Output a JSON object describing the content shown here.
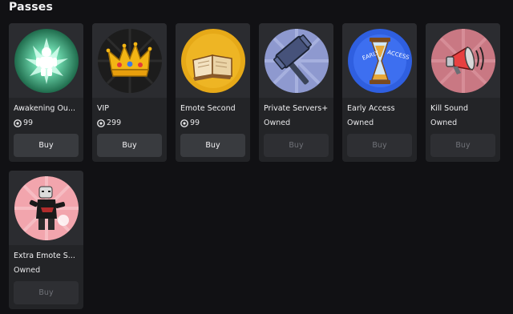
{
  "section": {
    "title": "Passes"
  },
  "passes": [
    {
      "name": "Awakening Ou...",
      "price": "99",
      "owned": false,
      "buy_label": "Buy",
      "icon": "awakening-aura-icon"
    },
    {
      "name": "VIP",
      "price": "299",
      "owned": false,
      "buy_label": "Buy",
      "icon": "crown-icon"
    },
    {
      "name": "Emote Second",
      "price": "99",
      "owned": false,
      "buy_label": "Buy",
      "icon": "book-icon"
    },
    {
      "name": "Private Servers+",
      "status": "Owned",
      "owned": true,
      "buy_label": "Buy",
      "icon": "hammer-icon"
    },
    {
      "name": "Early Access",
      "status": "Owned",
      "owned": true,
      "buy_label": "Buy",
      "icon": "hourglass-icon",
      "icon_text": [
        "EARLY",
        "ACCESS"
      ]
    },
    {
      "name": "Kill Sound",
      "status": "Owned",
      "owned": true,
      "buy_label": "Buy",
      "icon": "megaphone-icon"
    },
    {
      "name": "Extra Emote S...",
      "status": "Owned",
      "owned": true,
      "buy_label": "Buy",
      "icon": "dancing-character-icon"
    }
  ],
  "colors": {
    "background": "#111114",
    "card": "#232427",
    "button": "#393b3f",
    "button_disabled": "#2e2f33"
  }
}
